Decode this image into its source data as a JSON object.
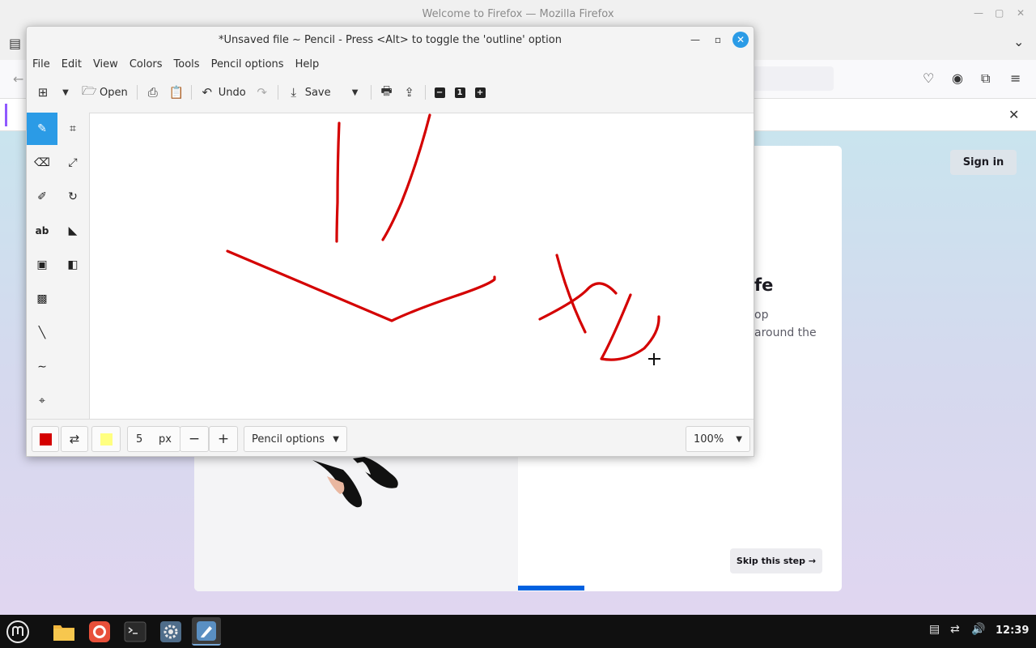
{
  "firefox": {
    "window_title": "Welcome to Firefox — Mozilla Firefox",
    "heading_fragment": "fe",
    "desc_line1": "op",
    "desc_line2": "around the",
    "sign_in": "Sign in",
    "skip": "Skip this step →"
  },
  "pencil": {
    "title": "*Unsaved file ~ Pencil - Press <Alt> to toggle the 'outline' option",
    "menu": [
      "File",
      "Edit",
      "View",
      "Colors",
      "Tools",
      "Pencil options",
      "Help"
    ],
    "toolbar": {
      "open": "Open",
      "undo": "Undo",
      "save": "Save",
      "zoom_one": "1"
    },
    "tools": {
      "text": "ab"
    },
    "bottombar": {
      "size_value": "5",
      "size_unit": "px",
      "options_label": "Pencil options",
      "zoom": "100%"
    },
    "colors": {
      "primary": "#d40000",
      "secondary": "#ffff80",
      "accent": "#2b9be6"
    }
  },
  "taskbar": {
    "clock": "12:39"
  }
}
